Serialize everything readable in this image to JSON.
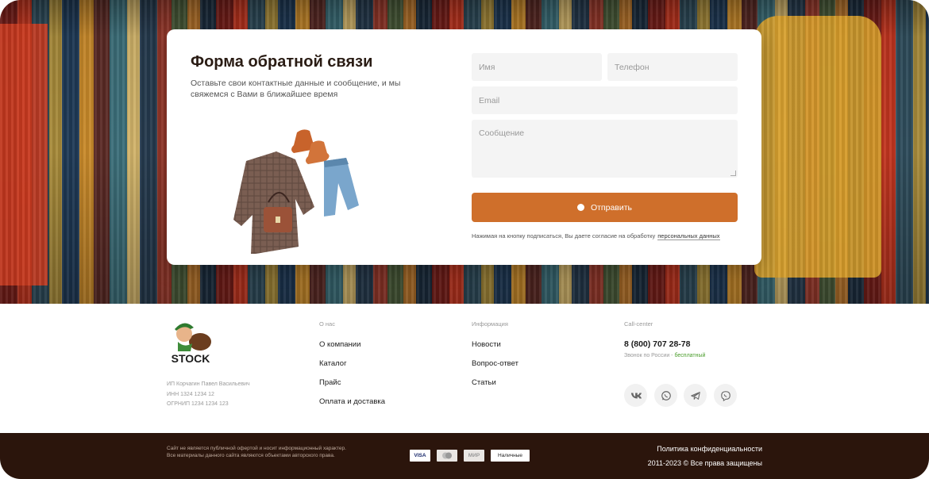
{
  "form": {
    "title": "Форма обратной связи",
    "subtitle": "Оставьте свои контактные данные и сообщение, и мы свяжемся с Вами в ближайшее время",
    "name_placeholder": "Имя",
    "phone_placeholder": "Телефон",
    "email_placeholder": "Email",
    "message_placeholder": "Сообщение",
    "submit_label": "Отправить",
    "consent_text": "Нажимая на кнопку подписаться, Вы даете согласие на обработку",
    "consent_link": "персональных данных"
  },
  "footer": {
    "logo_text": "STOCK",
    "legal": [
      "ИП Корчагин Павел Васильевич",
      "ИНН 1324 1234 12",
      "ОГРНИП 1234 1234 123"
    ],
    "about": {
      "heading": "О нас",
      "links": [
        "О компании",
        "Каталог",
        "Прайс",
        "Оплата и доставка"
      ]
    },
    "info": {
      "heading": "Информация",
      "links": [
        "Новости",
        "Вопрос-ответ",
        "Статьи"
      ]
    },
    "call": {
      "heading": "Call-center",
      "phone": "8 (800) 707 28-78",
      "note": "Звонок по России - ",
      "note_free": "бесплатный"
    },
    "social": [
      "vk-icon",
      "whatsapp-icon",
      "telegram-icon",
      "viber-icon"
    ]
  },
  "bottom": {
    "disclaimer": "Сайт не является публичной офертой и носит информационный характер. Все материалы данного сайта являются объектами авторского права.",
    "payments": [
      "VISA",
      "",
      "МИР",
      "Наличные"
    ],
    "policy": "Политика конфиденциальности",
    "copyright": "2011-2023 © Все права защищены"
  },
  "colors": {
    "accent": "#cf6f2b",
    "bottom_bar": "#2b150c",
    "free_green": "#4a9d2b"
  }
}
